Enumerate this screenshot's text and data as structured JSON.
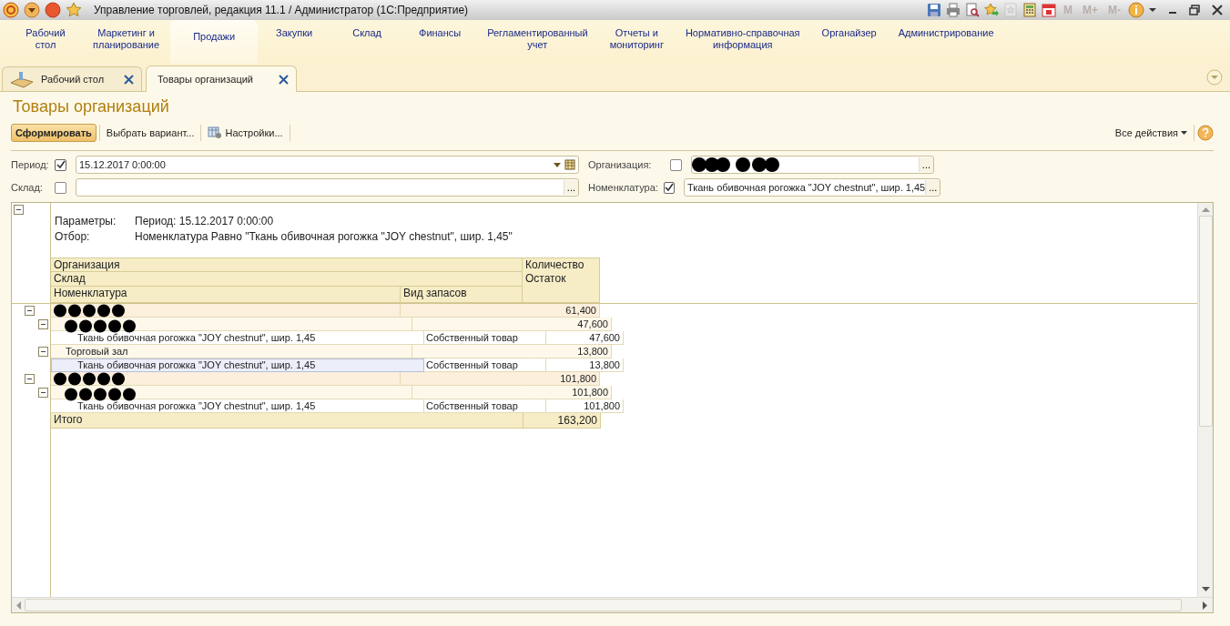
{
  "window": {
    "title": "Управление торговлей, редакция 11.1 / Администратор  (1С:Предприятие)",
    "memory_buttons": [
      {
        "label": "M",
        "disabled": true
      },
      {
        "label": "M+",
        "disabled": true
      },
      {
        "label": "M-",
        "disabled": true
      }
    ]
  },
  "sections": [
    {
      "label": "Рабочий\nстол",
      "selected": false
    },
    {
      "label": "Маркетинг и\nпланирование",
      "selected": false
    },
    {
      "label": "Продажи",
      "selected": true
    },
    {
      "label": "Закупки",
      "selected": false
    },
    {
      "label": "Склад",
      "selected": false
    },
    {
      "label": "Финансы",
      "selected": false
    },
    {
      "label": "Регламентированный\nучет",
      "selected": false
    },
    {
      "label": "Отчеты и\nмониторинг",
      "selected": false
    },
    {
      "label": "Нормативно-справочная\nинформация",
      "selected": false
    },
    {
      "label": "Органайзер",
      "selected": false
    },
    {
      "label": "Администрирование",
      "selected": false
    }
  ],
  "tabs": [
    {
      "label": "Рабочий стол",
      "selected": false,
      "kind": "desktop"
    },
    {
      "label": "Товары организаций",
      "selected": true,
      "kind": "page"
    }
  ],
  "form": {
    "title": "Товары организаций",
    "buttons": [
      {
        "label": "Сформировать",
        "kind": "primary"
      },
      {
        "label": "Выбрать вариант...",
        "kind": "plain"
      },
      {
        "label": "Настройки...",
        "kind": "settings"
      }
    ],
    "all_actions": "Все действия"
  },
  "filters": [
    {
      "label": "Период:",
      "checked": true,
      "value": "15.12.2017  0:00:00",
      "kind": "date",
      "redacted": false
    },
    {
      "label": "Организация:",
      "checked": false,
      "kind": "choice",
      "button": "...",
      "redacted": true
    },
    {
      "label": "Склад:",
      "checked": false,
      "kind": "choice",
      "button": "...",
      "redacted": false
    },
    {
      "label": "Номенклатура:",
      "checked": true,
      "value": "Ткань обивочная рогожка \"JOY chestnut\", шир. 1,45",
      "kind": "choice",
      "button": "...",
      "redacted": false
    }
  ],
  "report": {
    "parameters": [
      {
        "label": "Параметры:",
        "value": "Период: 15.12.2017 0:00:00"
      },
      {
        "label": "Отбор:",
        "value": "Номенклатура Равно \"Ткань обивочная рогожка \"JOY chestnut\", шир. 1,45\""
      }
    ],
    "header": {
      "organization": "Организация",
      "warehouse": "Склад",
      "item": "Номенклатура",
      "stock_type": "Вид запасов",
      "quantity": "Количество",
      "balance": "Остаток"
    },
    "rows": [
      {
        "redacted": true,
        "quantity": "61,400",
        "children": [
          {
            "redacted": true,
            "quantity": "47,600",
            "children": [
              {
                "name": "Ткань обивочная рогожка \"JOY chestnut\", шир. 1,45",
                "stock_type": "Собственный товар",
                "quantity": "47,600",
                "selected": false
              }
            ]
          },
          {
            "name": "Торговый зал",
            "redacted": false,
            "quantity": "13,800",
            "children": [
              {
                "name": "Ткань обивочная рогожка \"JOY chestnut\", шир. 1,45",
                "stock_type": "Собственный товар",
                "quantity": "13,800",
                "selected": true
              }
            ]
          }
        ]
      },
      {
        "redacted": true,
        "quantity": "101,800",
        "children": [
          {
            "redacted": true,
            "quantity": "101,800",
            "children": [
              {
                "name": "Ткань обивочная рогожка \"JOY chestnut\", шир. 1,45",
                "stock_type": "Собственный товар",
                "quantity": "101,800",
                "selected": false
              }
            ]
          }
        ]
      }
    ],
    "total": {
      "label": "Итого",
      "value": "163,200"
    }
  }
}
